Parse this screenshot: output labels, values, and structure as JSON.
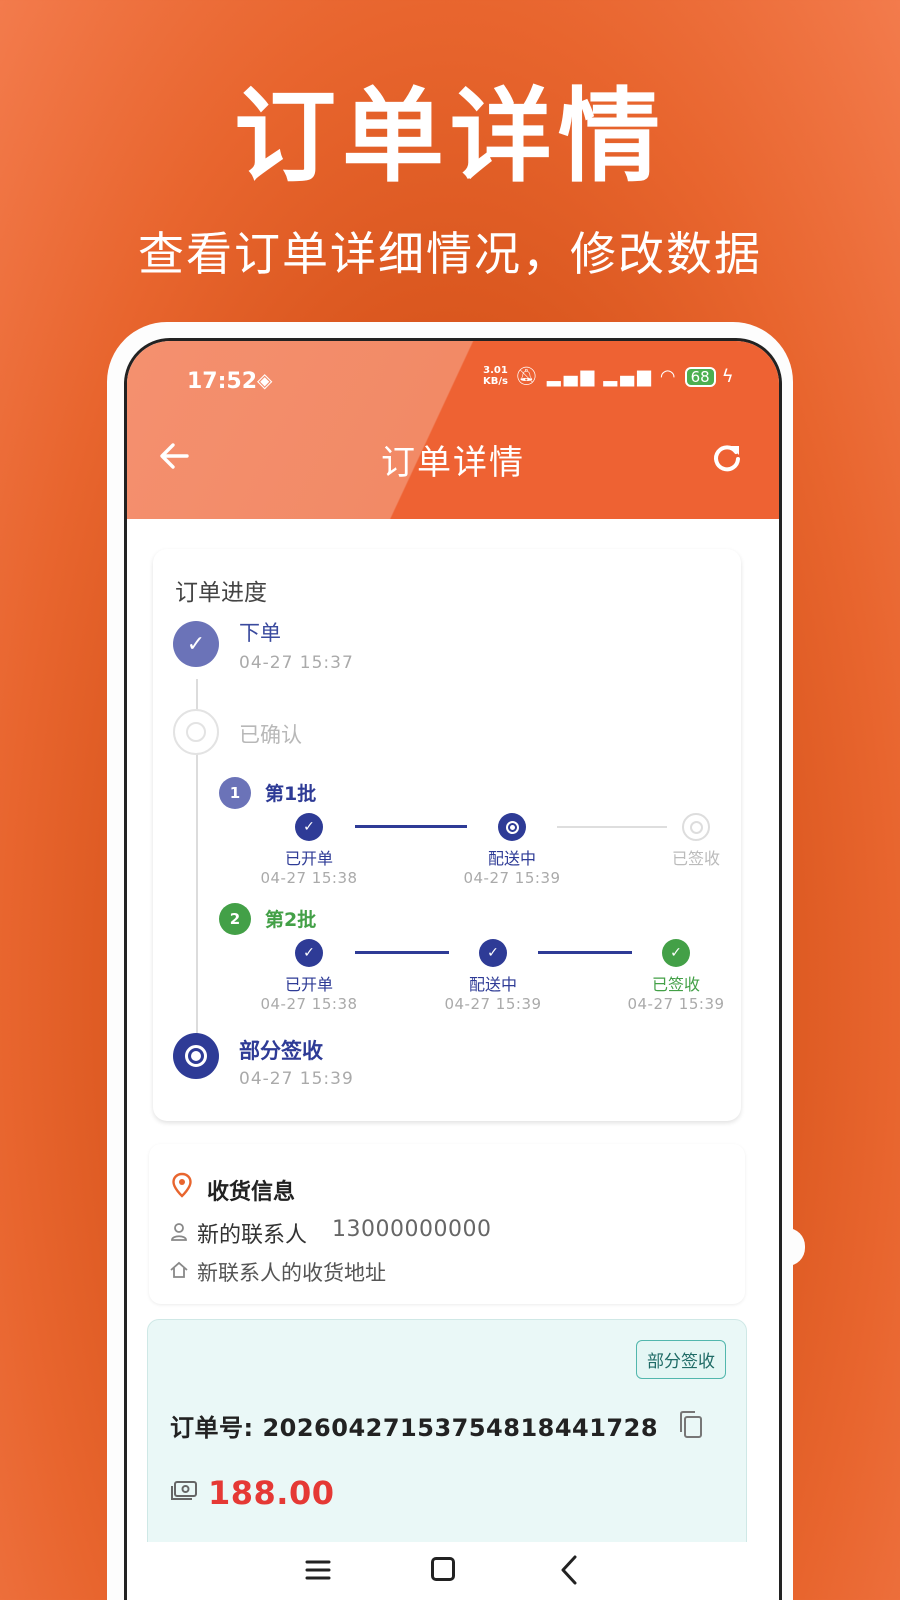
{
  "promo": {
    "title": "订单详情",
    "subtitle": "查看订单详细情况，修改数据"
  },
  "status_bar": {
    "time": "17:52",
    "net_speed_value": "3.01",
    "net_speed_unit": "KB/s",
    "battery": "68"
  },
  "header": {
    "title": "订单详情"
  },
  "progress": {
    "title": "订单进度",
    "steps": [
      {
        "label": "下单",
        "time": "04-27 15:37"
      },
      {
        "label": "已确认"
      },
      {
        "label": "部分签收",
        "time": "04-27 15:39"
      }
    ],
    "batches": [
      {
        "number": "1",
        "title": "第1批",
        "stages": [
          {
            "label": "已开单",
            "time": "04-27 15:38"
          },
          {
            "label": "配送中",
            "time": "04-27 15:39"
          },
          {
            "label": "已签收"
          }
        ]
      },
      {
        "number": "2",
        "title": "第2批",
        "stages": [
          {
            "label": "已开单",
            "time": "04-27 15:38"
          },
          {
            "label": "配送中",
            "time": "04-27 15:39"
          },
          {
            "label": "已签收",
            "time": "04-27 15:39"
          }
        ]
      }
    ]
  },
  "address": {
    "title": "收货信息",
    "name": "新的联系人",
    "phone": "13000000000",
    "detail": "新联系人的收货地址"
  },
  "order": {
    "status_badge": "部分签收",
    "order_no": "订单号: 20260427153754818441728",
    "amount": "188.00"
  },
  "colors": {
    "accent": "#ee6233",
    "primary_blue": "#2e3b96",
    "success_green": "#43a047",
    "amount_red": "#e53935"
  }
}
